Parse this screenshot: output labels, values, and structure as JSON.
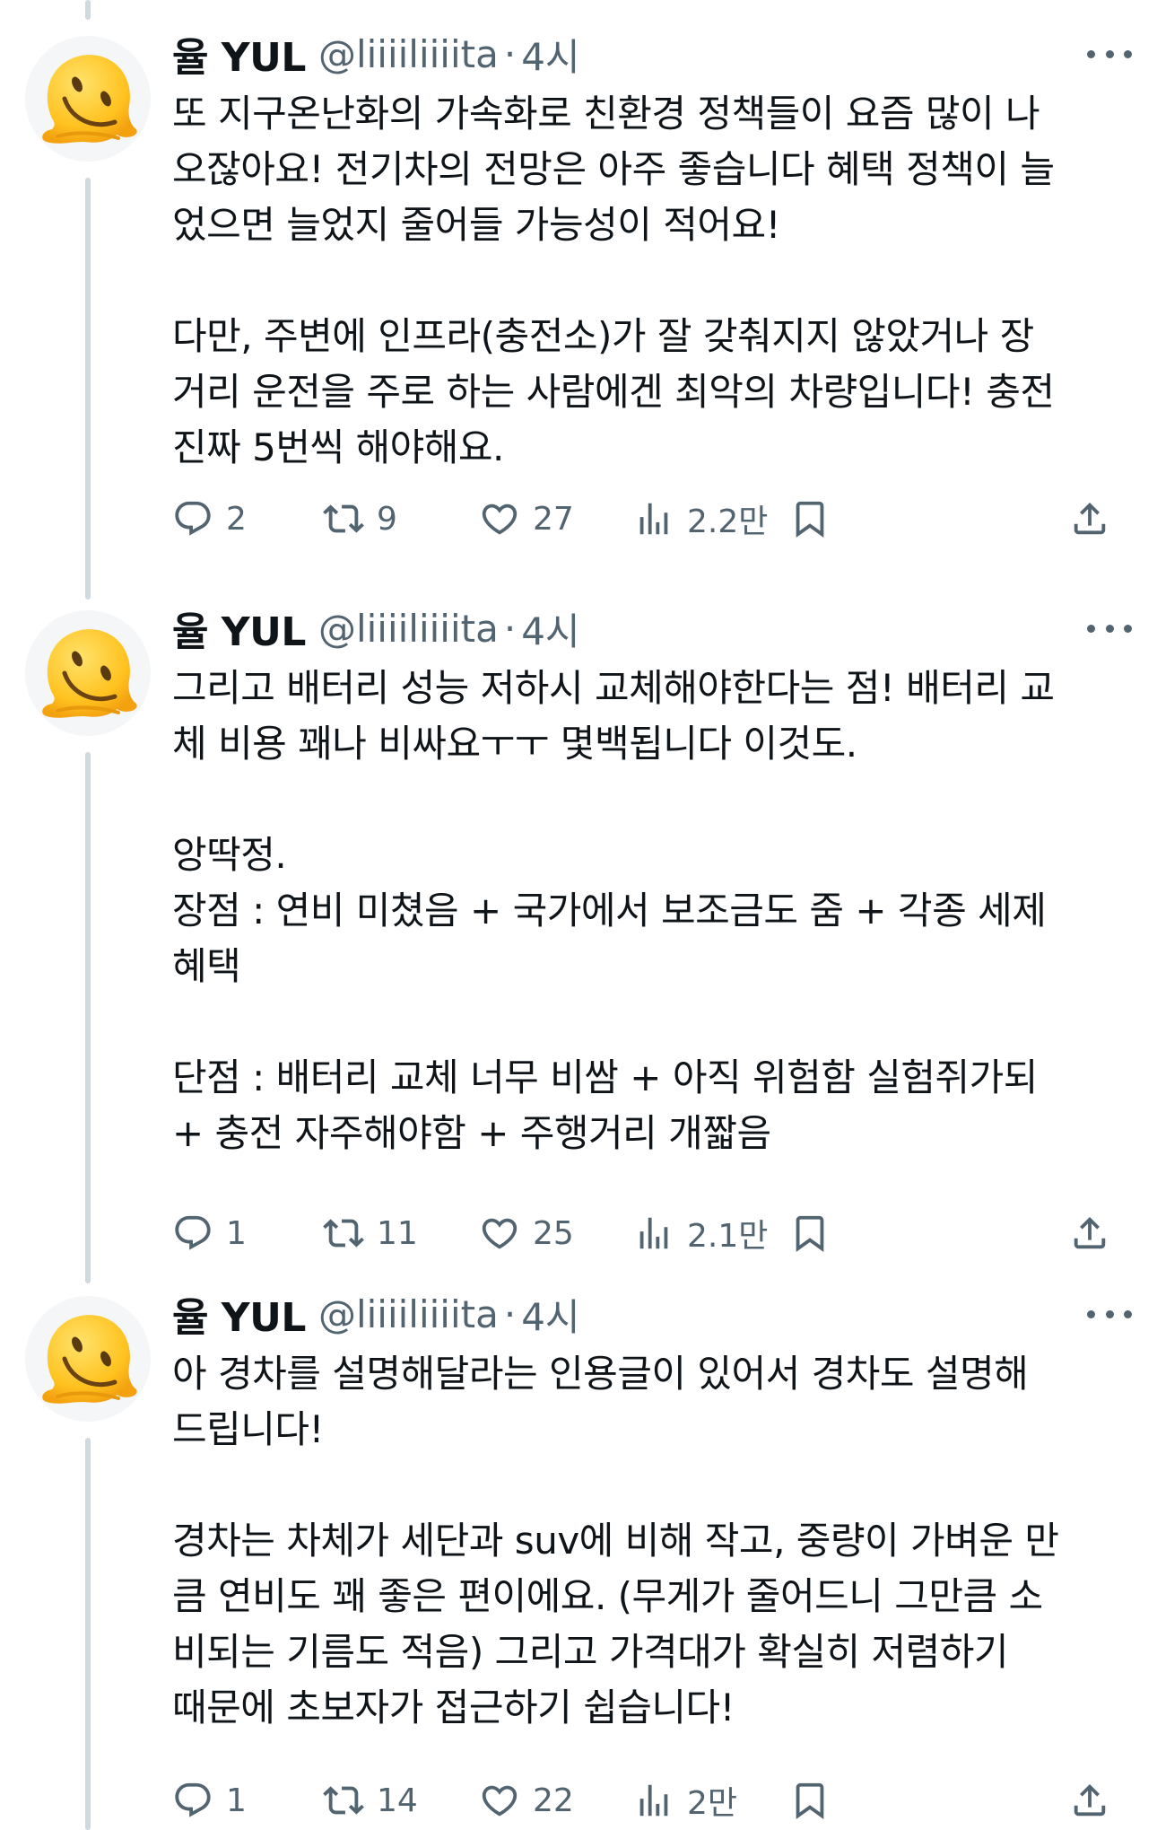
{
  "tweets": [
    {
      "author": {
        "name": "율 YUL",
        "handle": "@liiiiliiiita"
      },
      "separator": "·",
      "time": "4시",
      "paragraphs": [
        [
          "또 지구온난화의 가속화로 친환경 정책들이 요즘 많이 나",
          "오잖아요! 전기차의 전망은 아주 좋습니다 혜택 정책이 늘",
          "었으면 늘었지 줄어들 가능성이 적어요!"
        ],
        [
          "다만, 주변에 인프라(충전소)가 잘 갖춰지지 않았거나 장",
          "거리 운전을 주로 하는 사람에겐 최악의 차량입니다! 충전",
          "진짜 5번씩 해야해요."
        ]
      ],
      "stats": {
        "replies": "2",
        "retweets": "9",
        "likes": "27",
        "views": "2.2만"
      }
    },
    {
      "author": {
        "name": "율 YUL",
        "handle": "@liiiiliiiita"
      },
      "separator": "·",
      "time": "4시",
      "paragraphs": [
        [
          "그리고 배터리 성능 저하시 교체해야한다는 점! 배터리 교",
          "체 비용 꽤나 비싸요ㅜㅜ 몇백됩니다 이것도."
        ],
        [
          "앙딱정.",
          "장점 : 연비 미쳤음 + 국가에서 보조금도 줌 + 각종 세제",
          "혜택"
        ],
        [
          "단점 : 배터리 교체 너무 비쌈 + 아직 위험함 실험쥐가되",
          "+ 충전 자주해야함 + 주행거리 개짧음"
        ]
      ],
      "stats": {
        "replies": "1",
        "retweets": "11",
        "likes": "25",
        "views": "2.1만"
      }
    },
    {
      "author": {
        "name": "율 YUL",
        "handle": "@liiiiliiiita"
      },
      "separator": "·",
      "time": "4시",
      "paragraphs": [
        [
          "아 경차를 설명해달라는 인용글이 있어서 경차도 설명해",
          "드립니다!"
        ],
        [
          "경차는 차체가 세단과 suv에 비해 작고, 중량이 가벼운 만",
          "큼 연비도 꽤 좋은 편이에요. (무게가 줄어드니 그만큼 소",
          "비되는 기름도 적음) 그리고 가격대가 확실히 저렴하기",
          "때문에 초보자가 접근하기 쉽습니다!"
        ]
      ],
      "stats": {
        "replies": "1",
        "retweets": "14",
        "likes": "22",
        "views": "2만"
      }
    }
  ],
  "icons": {
    "reply": "reply-icon",
    "retweet": "retweet-icon",
    "like": "heart-icon",
    "views": "views-icon",
    "bookmark": "bookmark-icon",
    "share": "share-icon",
    "more": "more-icon",
    "avatar": "melting-face-emoji"
  },
  "colors": {
    "text": "#0f1419",
    "secondary": "#536471",
    "thread_line": "#cfd9de",
    "avatar_yellow": "#ffcc33"
  }
}
